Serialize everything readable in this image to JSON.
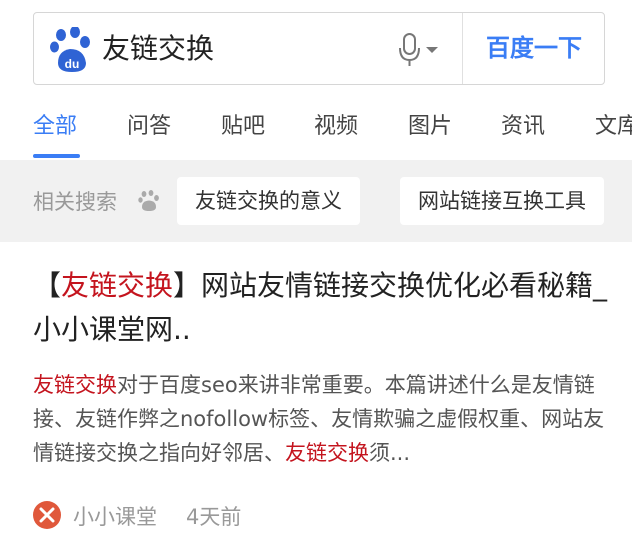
{
  "search": {
    "query": "友链交换",
    "button_label": "百度一下"
  },
  "tabs": [
    {
      "label": "全部",
      "active": true
    },
    {
      "label": "问答"
    },
    {
      "label": "贴吧"
    },
    {
      "label": "视频"
    },
    {
      "label": "图片"
    },
    {
      "label": "资讯"
    },
    {
      "label": "文库"
    }
  ],
  "related": {
    "label": "相关搜索",
    "chips": [
      "友链交换的意义",
      "网站链接互换工具"
    ]
  },
  "result": {
    "title_bracket_open": "【",
    "title_highlight": "友链交换",
    "title_bracket_close": "】",
    "title_rest": "网站友情链接交换优化必看秘籍_小小课堂网..",
    "snippet_hl_1": "友链交换",
    "snippet_text_1": "对于百度seo来讲非常重要。本篇讲述什么是友情链接、友链作弊之nofollow标签、友情欺骗之虚假权重、网站友情链接交换之指向好邻居、",
    "snippet_hl_2": "友链交换",
    "snippet_text_2": "须...",
    "source_name": "小小课堂",
    "source_time": "4天前"
  },
  "colors": {
    "accent": "#3a7df5",
    "highlight": "#c4141e",
    "source_icon": "#e0583b"
  },
  "icons": {
    "logo": "baidu-paw-logo-icon",
    "mic": "microphone-icon",
    "dropdown": "chevron-down-icon",
    "related": "paw-icon",
    "source": "x-circle-icon"
  }
}
